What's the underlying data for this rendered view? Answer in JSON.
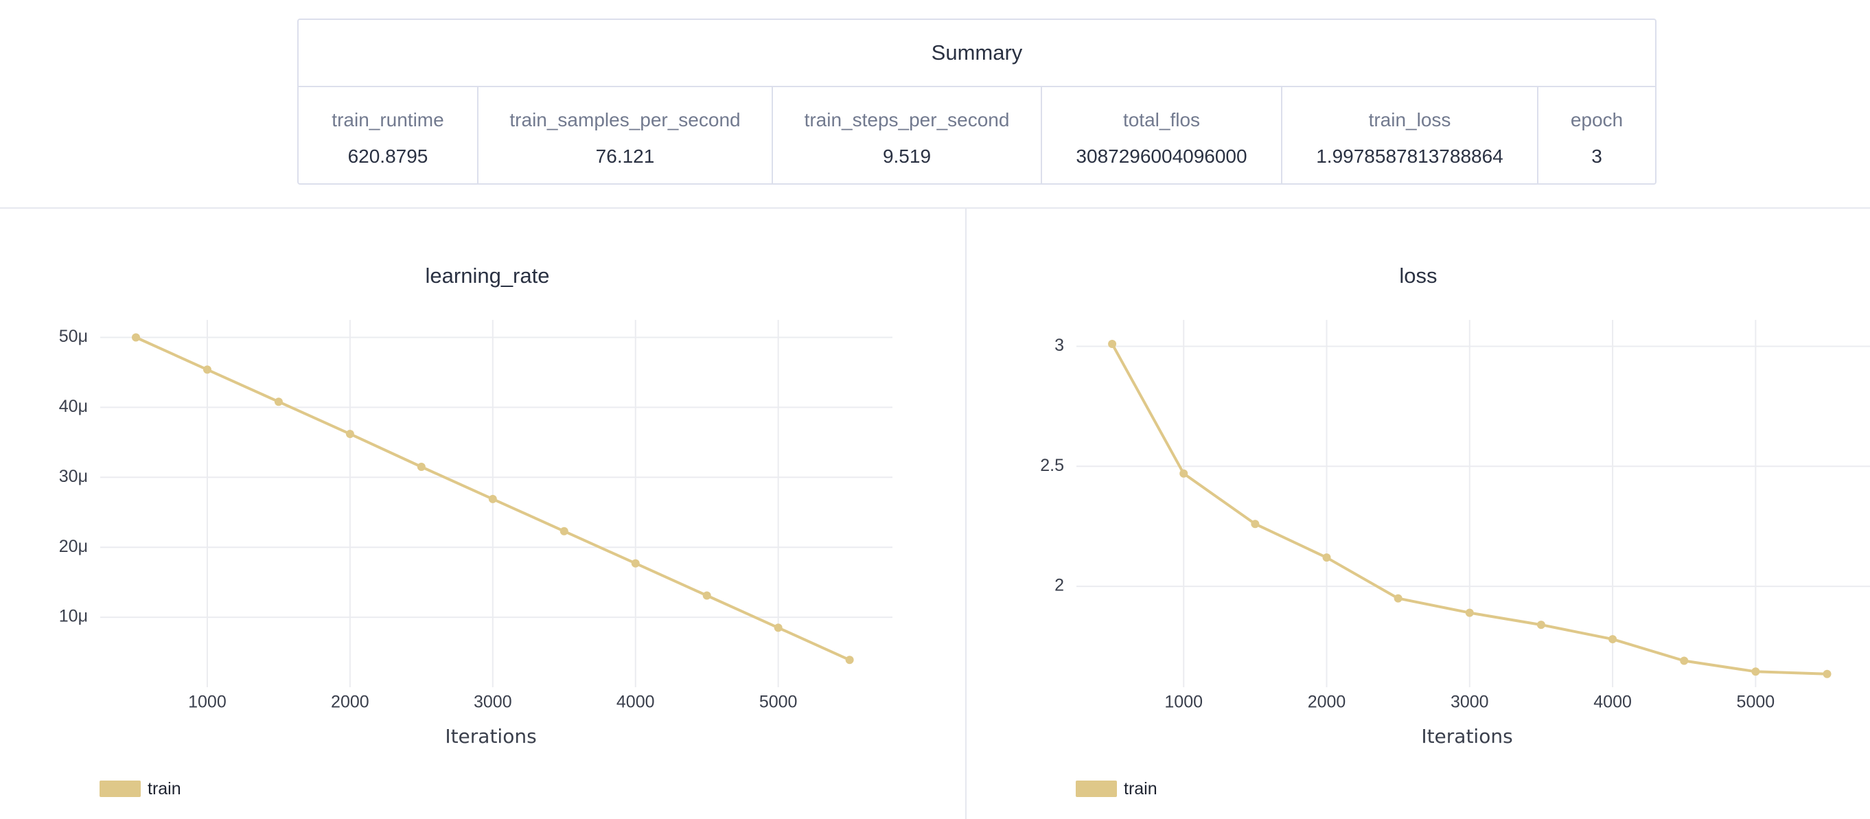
{
  "summary": {
    "title": "Summary",
    "columns": [
      {
        "key": "train_runtime",
        "value": "620.8795"
      },
      {
        "key": "train_samples_per_second",
        "value": "76.121"
      },
      {
        "key": "train_steps_per_second",
        "value": "9.519"
      },
      {
        "key": "total_flos",
        "value": "3087296004096000"
      },
      {
        "key": "train_loss",
        "value": "1.9978587813788864"
      },
      {
        "key": "epoch",
        "value": "3"
      }
    ]
  },
  "colors": {
    "series": "#dfc889",
    "grid": "#ebecf0",
    "divider": "#e6e8ef"
  },
  "chart_data": [
    {
      "type": "line",
      "title": "learning_rate",
      "xlabel": "Iterations",
      "ylabel": "",
      "xlim": [
        250,
        5800
      ],
      "ylim": [
        0,
        52.5
      ],
      "xticks": [
        1000,
        2000,
        3000,
        4000,
        5000
      ],
      "yticks": [
        {
          "value": 10,
          "label": "10μ"
        },
        {
          "value": 20,
          "label": "20μ"
        },
        {
          "value": 30,
          "label": "30μ"
        },
        {
          "value": 40,
          "label": "40μ"
        },
        {
          "value": 50,
          "label": "50μ"
        }
      ],
      "grid": true,
      "legend_position": "bottom-left",
      "series": [
        {
          "name": "train",
          "x": [
            500,
            1000,
            1500,
            2000,
            2500,
            3000,
            3500,
            4000,
            4500,
            5000,
            5500
          ],
          "y": [
            50.0,
            45.4,
            40.8,
            36.2,
            31.5,
            26.9,
            22.3,
            17.7,
            13.1,
            8.5,
            3.9
          ]
        }
      ]
    },
    {
      "type": "line",
      "title": "loss",
      "xlabel": "Iterations",
      "ylabel": "",
      "xlim": [
        250,
        5800
      ],
      "ylim": [
        1.58,
        3.11
      ],
      "xticks": [
        1000,
        2000,
        3000,
        4000,
        5000
      ],
      "yticks": [
        {
          "value": 2,
          "label": "2"
        },
        {
          "value": 2.5,
          "label": "2.5"
        },
        {
          "value": 3,
          "label": "3"
        }
      ],
      "grid": true,
      "legend_position": "bottom-left",
      "series": [
        {
          "name": "train",
          "x": [
            500,
            1000,
            1500,
            2000,
            2500,
            3000,
            3500,
            4000,
            4500,
            5000,
            5500
          ],
          "y": [
            3.01,
            2.47,
            2.26,
            2.12,
            1.95,
            1.89,
            1.84,
            1.78,
            1.69,
            1.645,
            1.635
          ]
        }
      ]
    }
  ]
}
